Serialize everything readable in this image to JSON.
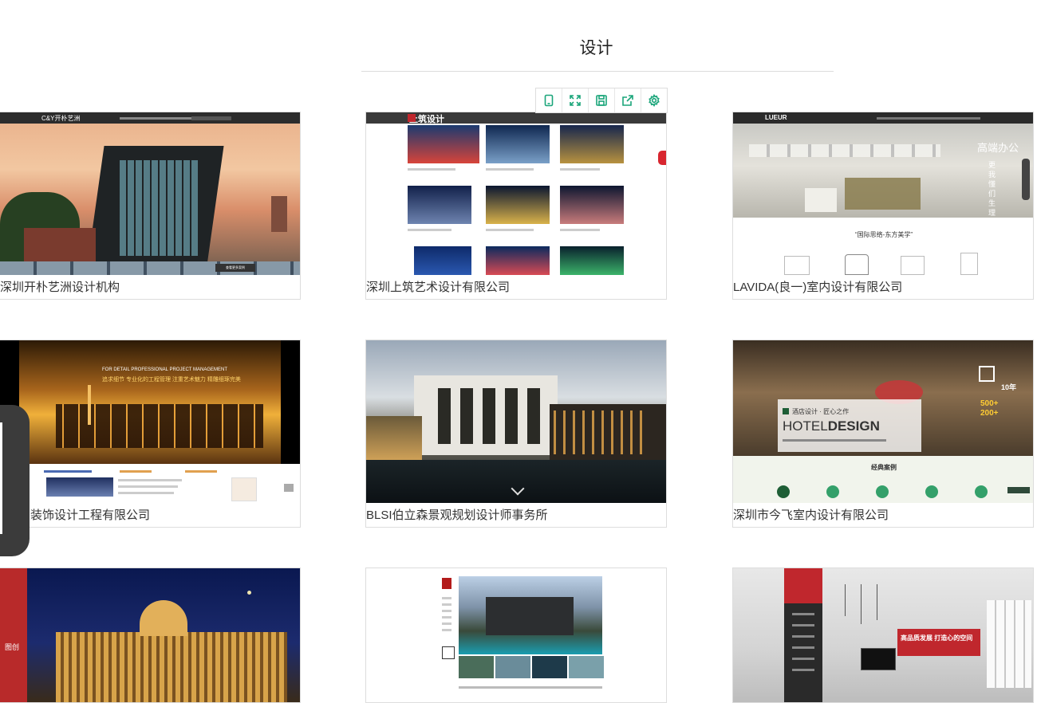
{
  "section": {
    "title": "设计"
  },
  "toolbar": {
    "items": [
      {
        "name": "mobile-preview-icon"
      },
      {
        "name": "fullscreen-icon"
      },
      {
        "name": "save-icon"
      },
      {
        "name": "share-icon"
      },
      {
        "name": "settings-icon"
      }
    ]
  },
  "cards": [
    {
      "caption": "深圳开朴艺洲设计机构",
      "thumb": {
        "logo": "C&Y开朴艺洲",
        "banner_button": "查看更多案例"
      }
    },
    {
      "caption": "深圳上筑艺术设计有限公司",
      "thumb": {
        "logo": "上筑设计"
      }
    },
    {
      "caption": "LAVIDA(良一)室内设计有限公司",
      "thumb": {
        "logo": "LUEUR",
        "banner_title": "高端办公",
        "banner_side": "更我懂们生理活解设计",
        "tagline": "“国际思络-东方美学”"
      }
    },
    {
      "caption": "装饰设计工程有限公司",
      "thumb": {
        "headline_en": "FOR DETAIL PROFESSIONAL PROJECT MANAGEMENT",
        "headline_cn": "追求细节 专业化的工程管理 注重艺术魅力 精雕细琢完美"
      }
    },
    {
      "caption": "BLSI伯立森景观规划设计师事务所",
      "thumb": {}
    },
    {
      "caption": "深圳市今飞室内设计有限公司",
      "thumb": {
        "hotel_cn": "酒店设计 · 匠心之作",
        "hotel_en_light": "HOTEL",
        "hotel_en_bold": "DESIGN",
        "years": "10年",
        "stat1": "500+",
        "stat2": "200+",
        "section_title": "经典案例"
      }
    },
    {
      "caption": "",
      "thumb": {
        "logo_text": "图创"
      }
    },
    {
      "caption": "",
      "thumb": {}
    },
    {
      "caption": "",
      "thumb": {
        "slogan": "高品质发展 打造心的空间"
      }
    }
  ],
  "colors": {
    "accent": "#1aa57a",
    "caption": "#333333",
    "side_tab": "#3b3b3b"
  }
}
